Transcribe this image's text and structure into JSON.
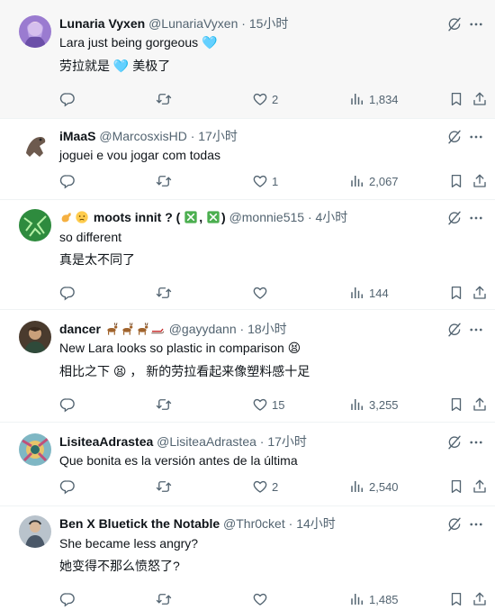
{
  "tweets": [
    {
      "name": "Lunaria Vyxen",
      "handle": "@LunariaVyxen",
      "sep": "·",
      "time": "15小时",
      "lines": [
        "Lara just being gorgeous 🩵",
        "劳拉就是 🩵 美极了"
      ],
      "replies": "",
      "retweets": "",
      "likes": "2",
      "views": "1,834"
    },
    {
      "name": "iMaaS",
      "handle": "@MarcosxisHD",
      "sep": "·",
      "time": "17小时",
      "lines": [
        "joguei e vou jogar com todas"
      ],
      "replies": "",
      "retweets": "",
      "likes": "1",
      "views": "2,067"
    },
    {
      "name": "moots innit ? (",
      "name_suffix": ")",
      "name_sep": ",",
      "handle": "@monnie515",
      "sep": "·",
      "time": "4小时",
      "lines": [
        "so different",
        "真是太不同了"
      ],
      "replies": "",
      "retweets": "",
      "likes": "",
      "views": "144"
    },
    {
      "name": "dancer",
      "handle": "@gayydann",
      "sep": "·",
      "time": "18小时",
      "lines": [
        "New Lara looks so plastic in comparison 😫",
        "相比之下 😫 ， 新的劳拉看起来像塑料感十足"
      ],
      "replies": "",
      "retweets": "",
      "likes": "15",
      "views": "3,255"
    },
    {
      "name": "LisiteaAdrastea",
      "handle": "@LisiteaAdrastea",
      "sep": "·",
      "time": "17小时",
      "lines": [
        "Que bonita es la versión antes de la última"
      ],
      "replies": "",
      "retweets": "",
      "likes": "2",
      "views": "2,540"
    },
    {
      "name": "Ben X Bluetick the Notable",
      "handle": "@Thr0cket",
      "sep": "·",
      "time": "14小时",
      "lines": [
        "She became less angry?",
        "她变得不那么愤怒了?"
      ],
      "replies": "",
      "retweets": "",
      "likes": "",
      "views": "1,485"
    }
  ],
  "colors": {
    "text": "#0f1419",
    "muted": "#536471",
    "divider": "#eff3f4",
    "heart_emoji": "#7cc3f0",
    "check_box": "#4caf50"
  },
  "icons": [
    "grok-icon",
    "more-icon",
    "reply-icon",
    "retweet-icon",
    "like-icon",
    "views-icon",
    "bookmark-icon",
    "share-icon"
  ]
}
